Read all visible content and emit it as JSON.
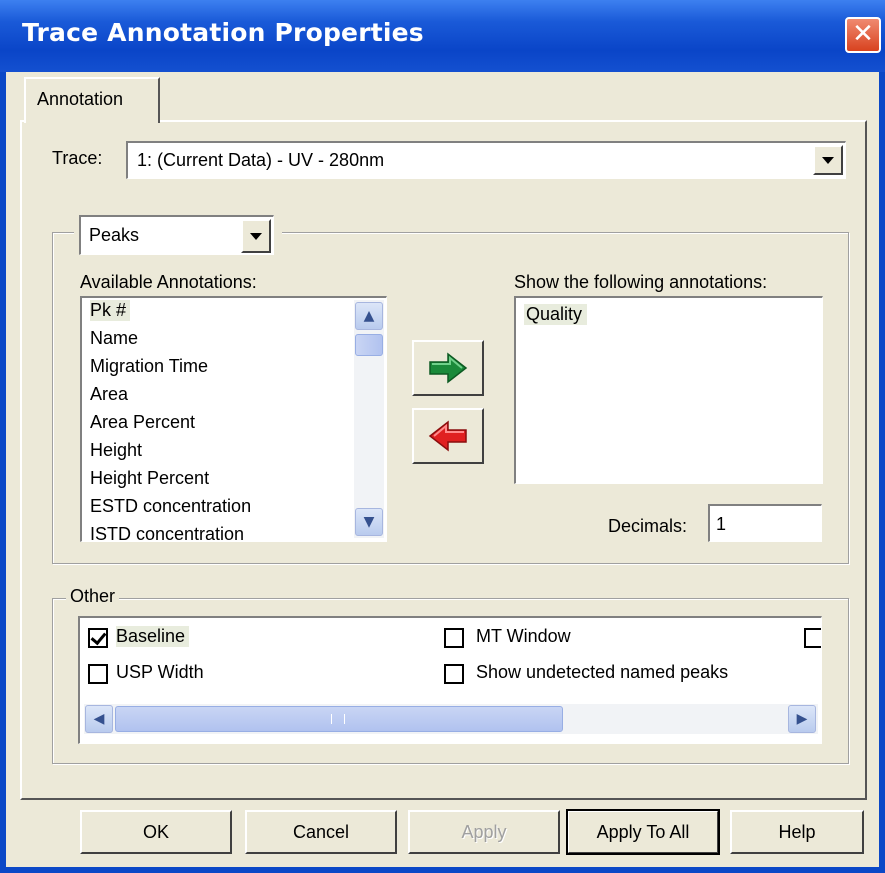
{
  "window": {
    "title": "Trace Annotation Properties",
    "close_glyph": "✕"
  },
  "tabs": [
    {
      "label": "Annotation"
    }
  ],
  "trace": {
    "label": "Trace:",
    "value": "1: (Current Data) - UV - 280nm"
  },
  "peaks": {
    "selector_value": "Peaks",
    "available_label": "Available Annotations:",
    "show_label": "Show the following annotations:",
    "available_items": [
      "Pk #",
      "Name",
      "Migration Time",
      "Area",
      "Area Percent",
      "Height",
      "Height Percent",
      "ESTD concentration",
      "ISTD concentration"
    ],
    "selected_available": "Pk #",
    "shown_items": [
      "Quality"
    ],
    "decimals_label": "Decimals:",
    "decimals_value": "1",
    "add_icon": "green-right-arrow-icon",
    "remove_icon": "red-left-arrow-icon"
  },
  "other": {
    "label": "Other",
    "options": [
      {
        "label": "Baseline",
        "checked": true
      },
      {
        "label": "MT Window",
        "checked": false
      },
      {
        "label": "",
        "checked": false
      },
      {
        "label": "USP Width",
        "checked": false
      },
      {
        "label": "Show undetected named peaks",
        "checked": false
      }
    ]
  },
  "buttons": {
    "ok": "OK",
    "cancel": "Cancel",
    "apply": "Apply",
    "apply_all": "Apply To All",
    "help": "Help"
  },
  "colors": {
    "titlebar": "#0a45c8",
    "dialog_bg": "#ece9d8",
    "add_arrow": "#1a8a3a",
    "remove_arrow": "#e02020",
    "close_button": "#d8421f"
  }
}
